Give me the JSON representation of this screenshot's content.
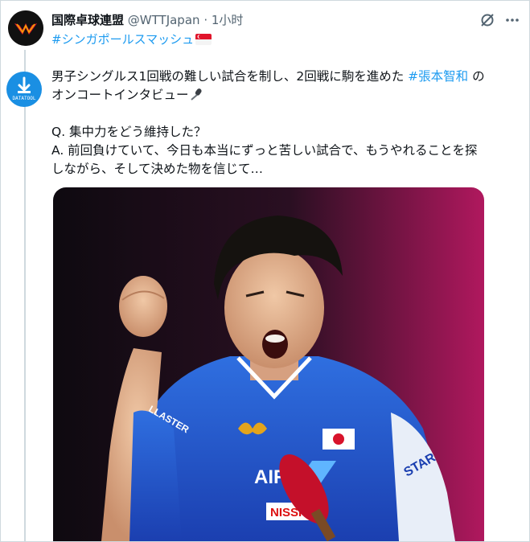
{
  "tweet": {
    "author_name": "国際卓球連盟",
    "handle": "@WTTJapan",
    "dot": "·",
    "time": "1小时",
    "tag_line": "#シンガポールスマッシュ",
    "flag_icon": "singapore-flag-icon",
    "retweeter_badge": "DATATOOL",
    "line1_prefix": "男子シングルス1回戦の難しい試合を制し、2回戦に駒を進めた ",
    "line1_hashtag": "#張本智和",
    "line1_suffix": " の",
    "line2": "オンコートインタビュー",
    "question": "Q. 集中力をどう維持した？",
    "answer_line1": "A. 前回負けていて、今日も本当にずっと苦しい試合で、もうやれることを探",
    "answer_line2": "しながら、そして決めた物を信じて…",
    "colors": {
      "link": "#1d9bf0",
      "muted": "#536471",
      "text": "#0f1419",
      "accent_red": "#e0142b"
    },
    "icons": [
      "grok-icon",
      "more-icon",
      "microphone-icon"
    ]
  },
  "photo": {
    "jersey_brand": "AIR",
    "sleeve_right": "STAR",
    "sleeve_left": "LLASTER",
    "sponsor": "NISSH",
    "flag": "japan-flag"
  }
}
